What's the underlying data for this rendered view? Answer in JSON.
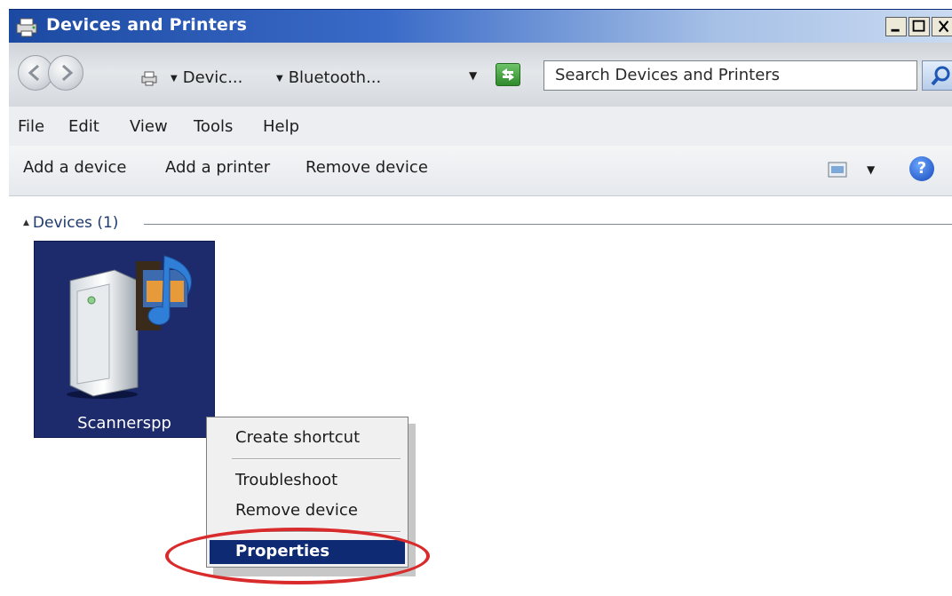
{
  "window": {
    "title": "Devices and Printers",
    "icon": "devices-printers-icon"
  },
  "address_bar": {
    "breadcrumb": [
      "Devic...",
      "Bluetooth..."
    ],
    "search_placeholder": "Search Devices and Printers"
  },
  "menu": {
    "items": [
      "File",
      "Edit",
      "View",
      "Tools",
      "Help"
    ]
  },
  "toolbar": {
    "add_device": "Add a device",
    "add_printer": "Add a printer",
    "remove_device": "Remove device"
  },
  "content": {
    "group_header": "Devices (1)",
    "devices": [
      {
        "label": "Scannerspp",
        "icon": "media-device-icon",
        "selected": true
      }
    ]
  },
  "context_menu": {
    "items": [
      "Create shortcut",
      "Troubleshoot",
      "Remove device",
      "Properties"
    ],
    "selected": "Properties"
  },
  "colors": {
    "titlebar_start": "#1c4aa2",
    "selection": "#0d2a73",
    "highlight_ring": "#d92b2b"
  }
}
